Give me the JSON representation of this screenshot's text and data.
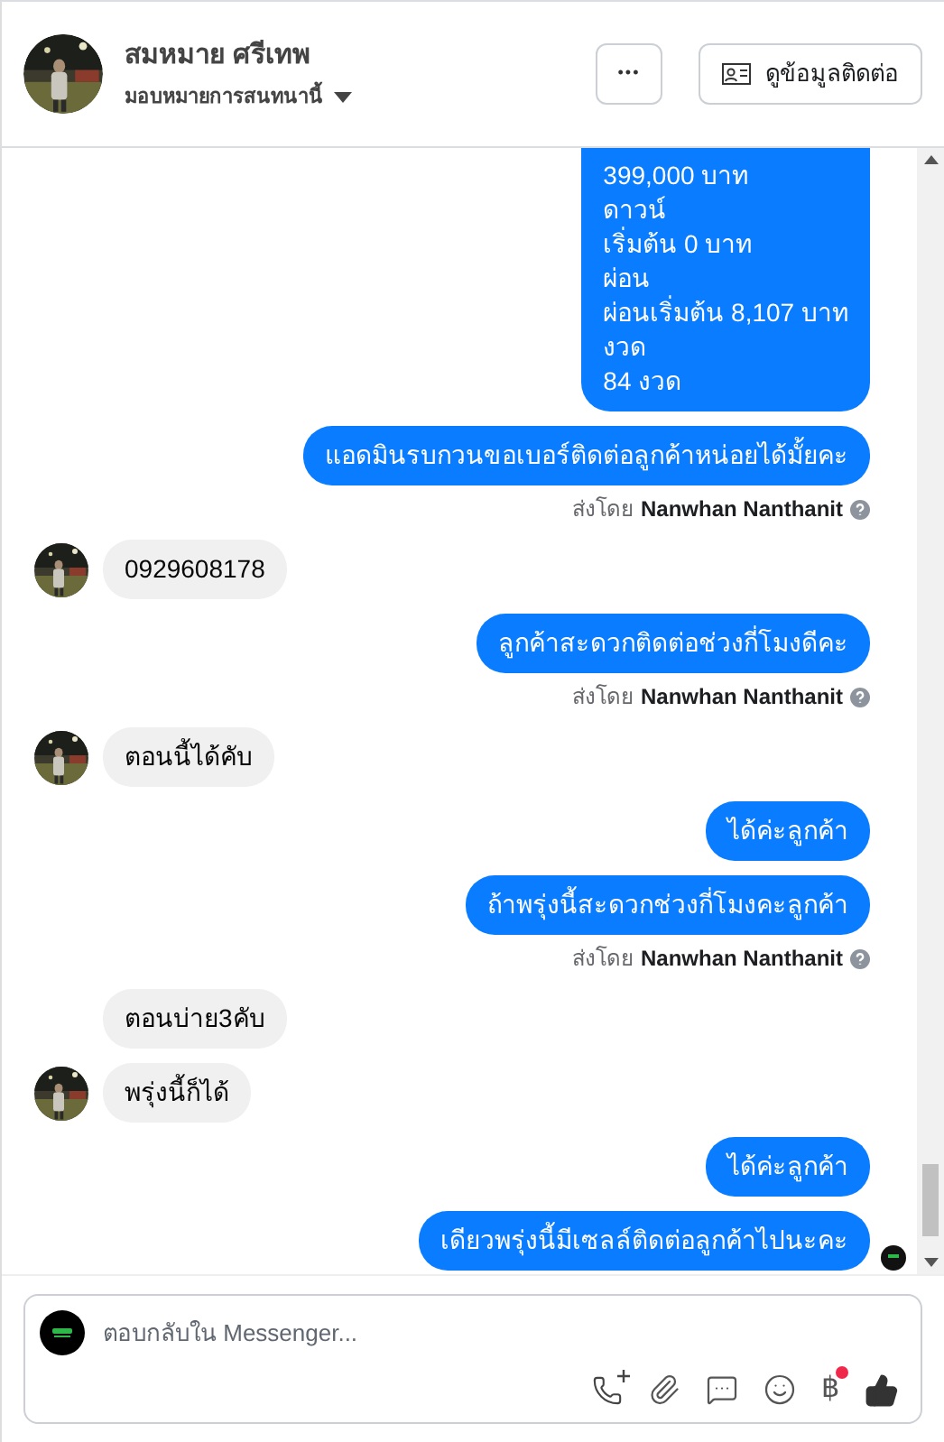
{
  "header": {
    "name": "สมหมาย ศรีเทพ",
    "assign_label": "มอบหมายการสนทนานี้",
    "more_button": "•••",
    "contact_button": "ดูข้อมูลติดต่อ"
  },
  "messages": [
    {
      "kind": "outgoing",
      "lines": [
        "399,000 บาท",
        "ดาวน์",
        "เริ่มต้น 0 บาท",
        "ผ่อน",
        "ผ่อนเริ่มต้น 8,107 บาท",
        "งวด",
        "84 งวด"
      ],
      "seen": false
    },
    {
      "kind": "outgoing",
      "lines": [
        "แอดมินรบกวนขอเบอร์ติดต่อลูกค้าหน่อยได้มั้ยคะ"
      ],
      "seen": false
    },
    {
      "kind": "sent_by",
      "prefix": "ส่งโดย",
      "name": "Nanwhan Nanthanit"
    },
    {
      "kind": "incoming",
      "text": "0929608178",
      "avatar": true
    },
    {
      "kind": "outgoing",
      "lines": [
        "ลูกค้าสะดวกติดต่อช่วงกี่โมงดีคะ"
      ],
      "seen": false
    },
    {
      "kind": "sent_by",
      "prefix": "ส่งโดย",
      "name": "Nanwhan Nanthanit"
    },
    {
      "kind": "incoming",
      "text": "ตอนนี้ได้คับ",
      "avatar": true
    },
    {
      "kind": "outgoing",
      "lines": [
        "ได้ค่ะลูกค้า"
      ],
      "seen": false
    },
    {
      "kind": "outgoing",
      "lines": [
        "ถ้าพรุ่งนี้สะดวกช่วงกี่โมงคะลูกค้า"
      ],
      "seen": false
    },
    {
      "kind": "sent_by",
      "prefix": "ส่งโดย",
      "name": "Nanwhan Nanthanit"
    },
    {
      "kind": "incoming",
      "text": "ตอนบ่าย3คับ",
      "avatar": false
    },
    {
      "kind": "incoming",
      "text": "พรุ่งนี้ก็ได้",
      "avatar": true
    },
    {
      "kind": "outgoing",
      "lines": [
        "ได้ค่ะลูกค้า"
      ],
      "seen": false
    },
    {
      "kind": "outgoing",
      "lines": [
        "เดียวพรุ่งนี้มีเซลล์ติดต่อลูกค้าไปนะคะ"
      ],
      "seen": true
    }
  ],
  "composer": {
    "placeholder": "ตอบกลับใน Messenger...",
    "baht_symbol": "฿",
    "baht_notification": true
  }
}
